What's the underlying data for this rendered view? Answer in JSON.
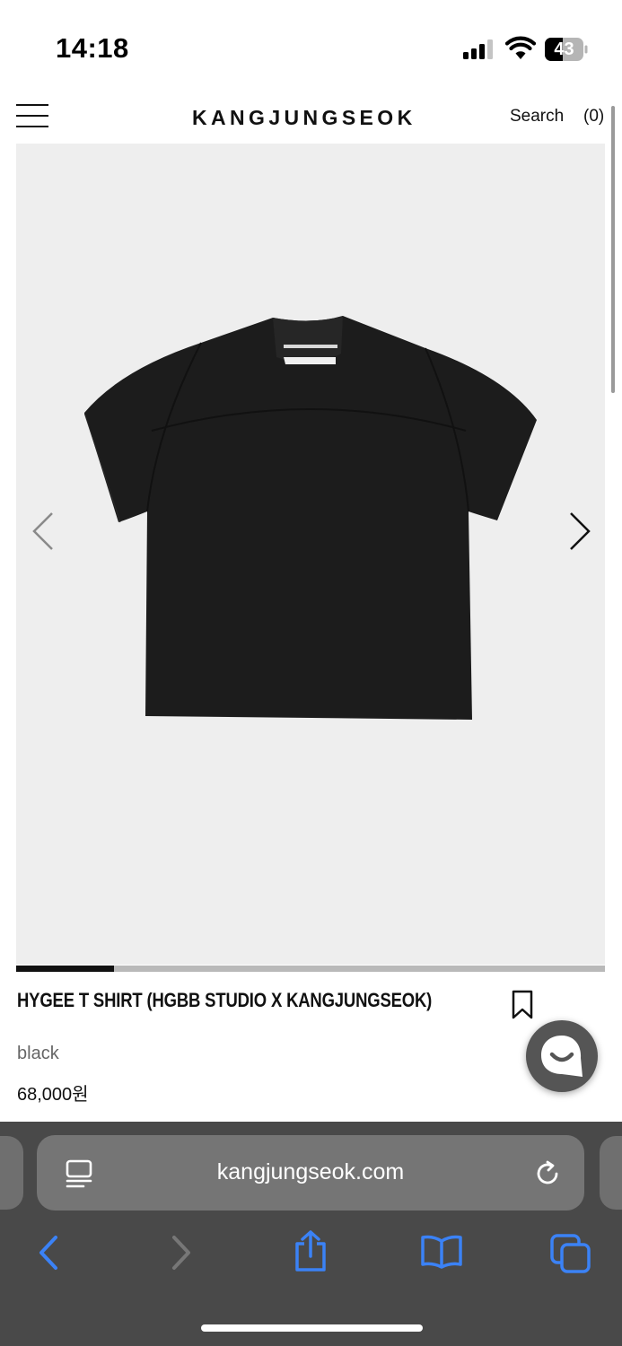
{
  "status_bar": {
    "time": "14:18",
    "battery_level": "43",
    "icons": [
      "cellular-signal-icon",
      "wifi-icon",
      "battery-icon"
    ]
  },
  "header": {
    "brand": "KANGJUNGSEOK",
    "search_label": "Search",
    "cart_count": "(0)",
    "menu_icon": "hamburger-menu-icon"
  },
  "gallery": {
    "image_alt": "black t-shirt",
    "prev_icon": "chevron-left-icon",
    "next_icon": "chevron-right-icon",
    "progress_fraction": 0.166
  },
  "product": {
    "name": "HYGEE T SHIRT (HGBB STUDIO X KANGJUNGSEOK)",
    "color": "black",
    "price": "68,000원"
  },
  "browser": {
    "url": "kangjungseok.com",
    "toolbar_icons": [
      "back-icon",
      "forward-icon",
      "share-icon",
      "bookmarks-icon",
      "tabs-icon"
    ]
  },
  "colors": {
    "accent": "#3b82f6",
    "product_bg": "#eeeeee",
    "browser_bg": "#494949",
    "chat_button": "#555555"
  }
}
